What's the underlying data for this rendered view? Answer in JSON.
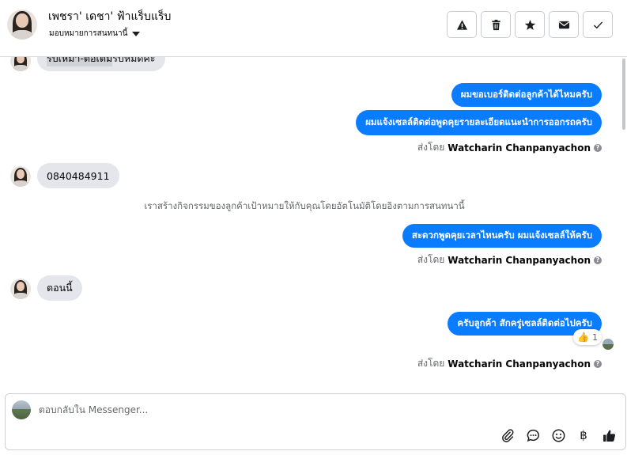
{
  "header": {
    "contact_name": "เพชรา' เดชา' ฟ้าแร็บแร็บ",
    "assign_label": "มอบหมายการสนทนานี้",
    "actions": [
      {
        "name": "warning-icon"
      },
      {
        "name": "trash-icon"
      },
      {
        "name": "star-icon"
      },
      {
        "name": "mail-icon"
      },
      {
        "name": "check-icon"
      }
    ]
  },
  "messages": {
    "m1": {
      "text_highlight": "รับเหมา-ต่อเติม",
      "text_rest": "รับหมดคะ"
    },
    "m2": {
      "text": "ผมขอเบอร์ติดต่อลูกค้าได้ไหมครับ"
    },
    "m3": {
      "text": "ผมแจ้งเซลล์ติดต่อพูดคุยรายละเอียดแนะนำการออกรถครับ"
    },
    "sent_by_prefix": "ส่งโดย",
    "sent_by_name": "Watcharin Chanpanyachon",
    "m4": {
      "text": "0840484911"
    },
    "system": "เราสร้างกิจกรรมของลูกค้าเป้าหมายให้กับคุณโดยอัตโนมัติโดยอิงตามการสนทนานี้",
    "m5": {
      "text": "สะดวกพูดคุยเวลาไหนครับ ผมแจ้งเซลล์ให้ครับ"
    },
    "m6": {
      "text": "ตอนนี้"
    },
    "m7": {
      "text": "ครับลูกค้า สักครู่เซลล์ติดต่อไปครับ"
    },
    "reaction": {
      "emoji": "👍",
      "count": "1"
    }
  },
  "composer": {
    "placeholder": "ตอบกลับใน Messenger...",
    "tools": [
      "paperclip-icon",
      "chat-bubble-icon",
      "emoji-icon",
      "baht-icon",
      "thumbs-up-icon"
    ],
    "baht_symbol": "฿"
  },
  "colors": {
    "outgoing": "#0a7cff",
    "incoming": "#e4e6eb"
  }
}
